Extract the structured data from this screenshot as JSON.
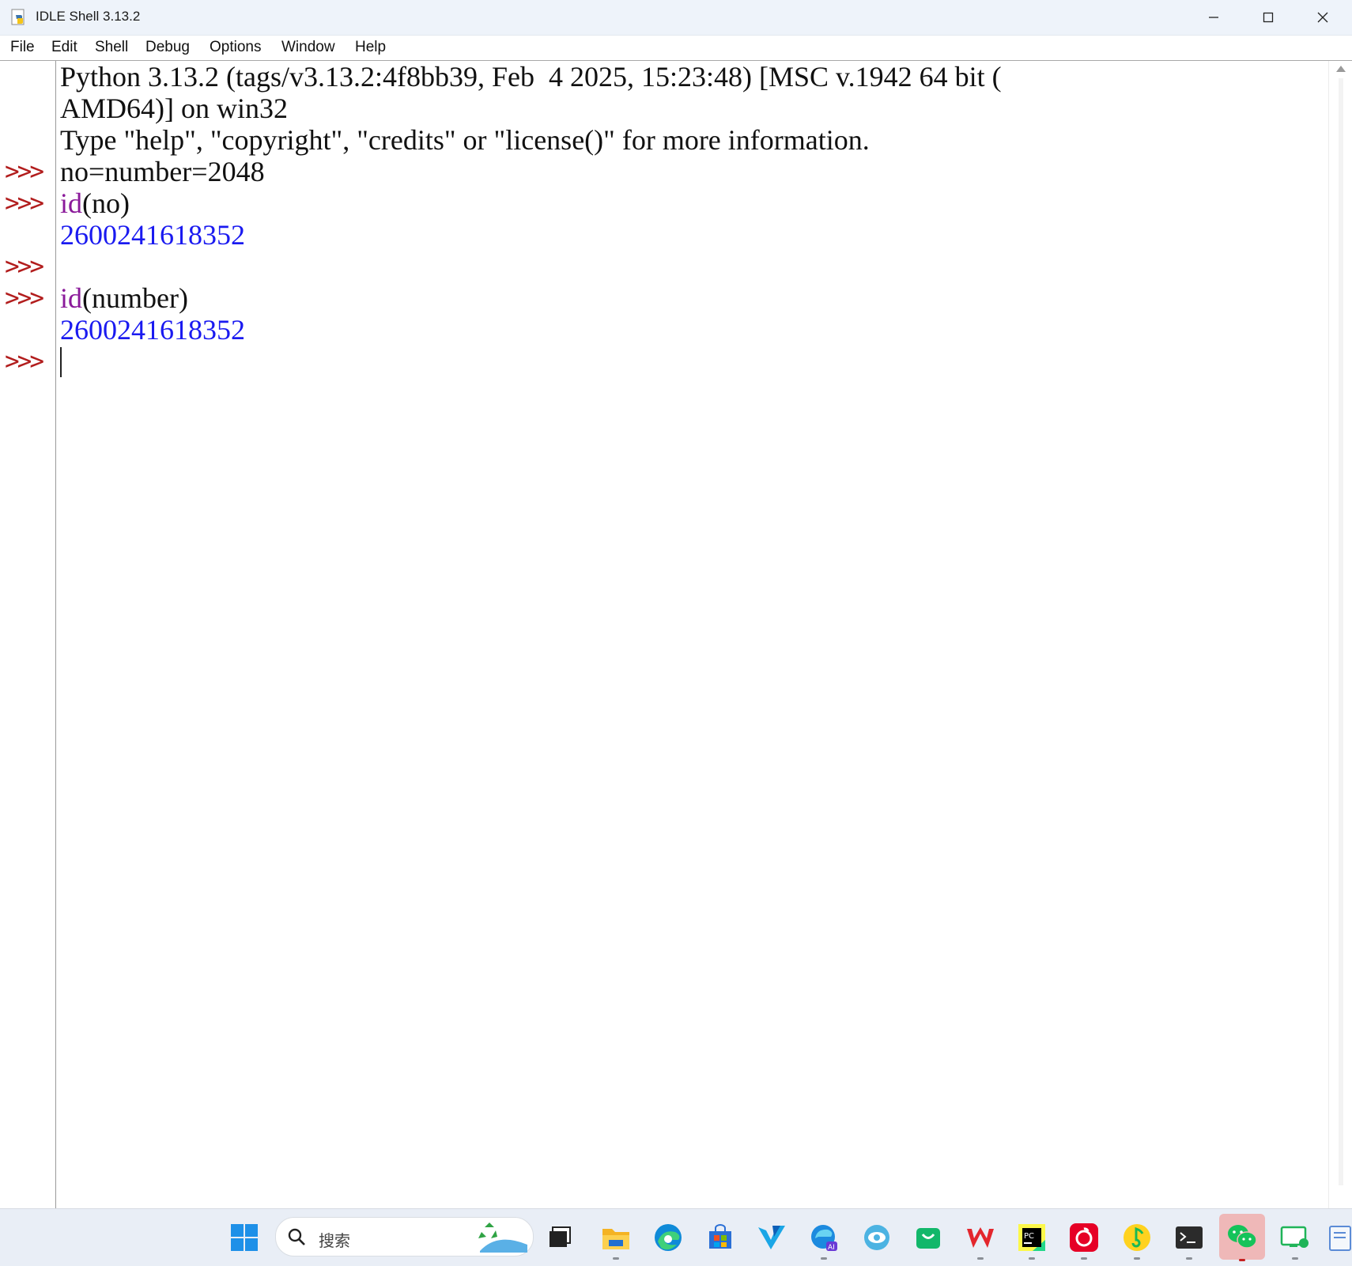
{
  "window": {
    "title": "IDLE Shell 3.13.2",
    "controls": {
      "minimize": "minimize",
      "maximize": "maximize",
      "close": "close"
    }
  },
  "menu": [
    "File",
    "Edit",
    "Shell",
    "Debug",
    "Options",
    "Window",
    "Help"
  ],
  "shell": {
    "banner_line1": "Python 3.13.2 (tags/v3.13.2:4f8bb39, Feb  4 2025, 15:23:48) [MSC v.1942 64 bit (",
    "banner_line2": "AMD64)] on win32",
    "banner_line3": "Type \"help\", \"copyright\", \"credits\" or \"license()\" for more information.",
    "prompt": ">>>",
    "input1": "no=number=2048",
    "input2_kw": "id",
    "input2_rest": "(no)",
    "output1": "2600241618352",
    "input3_kw": "id",
    "input3_rest": "(number)",
    "output2": "2600241618352"
  },
  "taskbar": {
    "search_placeholder": "搜索",
    "items": [
      "start-icon",
      "task-view-icon",
      "file-explorer-icon",
      "edge-icon",
      "store-icon",
      "app-v-icon",
      "edge-ai-icon",
      "eye-app-icon",
      "shop-bag-icon",
      "wps-icon",
      "pycharm-icon",
      "netease-music-icon",
      "qq-music-icon",
      "terminal-icon",
      "wechat-icon",
      "remote-icon",
      "notepad-icon"
    ],
    "colors": {
      "accent": "#0078d4",
      "prompt": "#b21d1d",
      "builtin": "#8b1a9a",
      "output": "#1a1af0"
    }
  }
}
